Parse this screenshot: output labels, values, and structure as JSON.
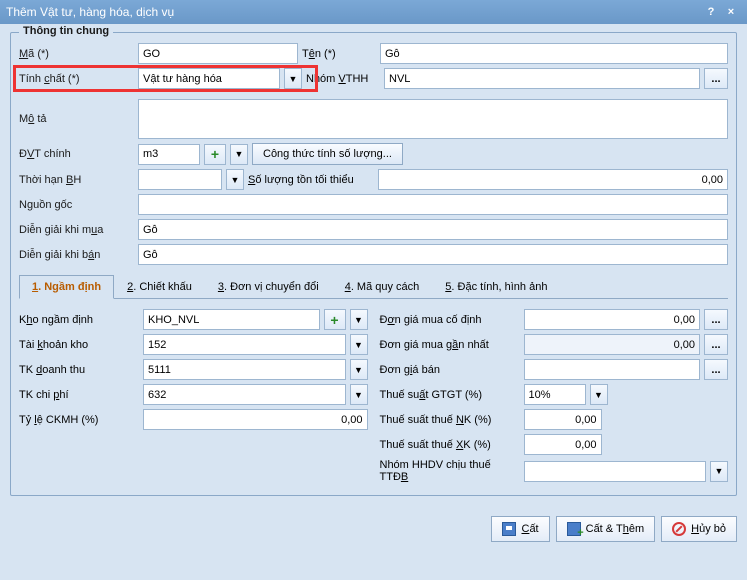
{
  "window": {
    "title": "Thêm Vật tư, hàng hóa, dịch vụ",
    "help": "?",
    "close": "×"
  },
  "fieldset": {
    "legend": "Thông tin chung"
  },
  "lbls": {
    "ma": "Mã (*)",
    "ten": "Tên (*)",
    "tinhchat": "Tính chất (*)",
    "nhom": "Nhóm VTHH",
    "mota": "Mô tả",
    "dvt": "ĐVT chính",
    "congthuc": "Công thức tính số lượng...",
    "thoihan": "Thời hạn BH",
    "soluong": "Số lượng tồn tối thiểu",
    "nguongoc": "Nguồn gốc",
    "diengiaimua": "Diễn giải khi mua",
    "diengiaiban": "Diễn giải khi bán"
  },
  "vals": {
    "ma": "GO",
    "ten": "Gỗ",
    "tinhchat": "Vật tư hàng hóa",
    "nhom": "NVL",
    "mota": "",
    "dvt": "m3",
    "thoihan": "",
    "soluong": "0,00",
    "nguongoc": "",
    "diengiaimua": "Gỗ",
    "diengiaiban": "Gỗ"
  },
  "tabs": {
    "t1": "1. Ngầm định",
    "t2": "2. Chiết khấu",
    "t3": "3. Đơn vị chuyển đổi",
    "t4": "4. Mã quy cách",
    "t5": "5. Đặc tính, hình ảnh"
  },
  "tab1": {
    "kho_lbl": "Kho ngầm định",
    "kho": "KHO_NVL",
    "tkkho_lbl": "Tài khoản kho",
    "tkkho": "152",
    "tkdt_lbl": "TK doanh thu",
    "tkdt": "5111",
    "tkcp_lbl": "TK chi phí",
    "tkcp": "632",
    "tyle_lbl": "Tỷ lệ CKMH (%)",
    "tyle": "0,00",
    "dgcd_lbl": "Đơn giá mua cố định",
    "dgcd": "0,00",
    "dggn_lbl": "Đơn giá mua gần nhất",
    "dggn": "0,00",
    "dgb_lbl": "Đơn giá bán",
    "dgb": "",
    "gtgt_lbl": "Thuế suất GTGT (%)",
    "gtgt": "10%",
    "nk_lbl": "Thuế suất thuế NK (%)",
    "nk": "0,00",
    "xk_lbl": "Thuế suất thuế XK (%)",
    "xk": "0,00",
    "ttdb_lbl": "Nhóm HHDV chịu thuế TTĐB",
    "ttdb": ""
  },
  "footer": {
    "save": "Cất",
    "saveadd": "Cất & Thêm",
    "cancel": "Hủy bỏ"
  }
}
